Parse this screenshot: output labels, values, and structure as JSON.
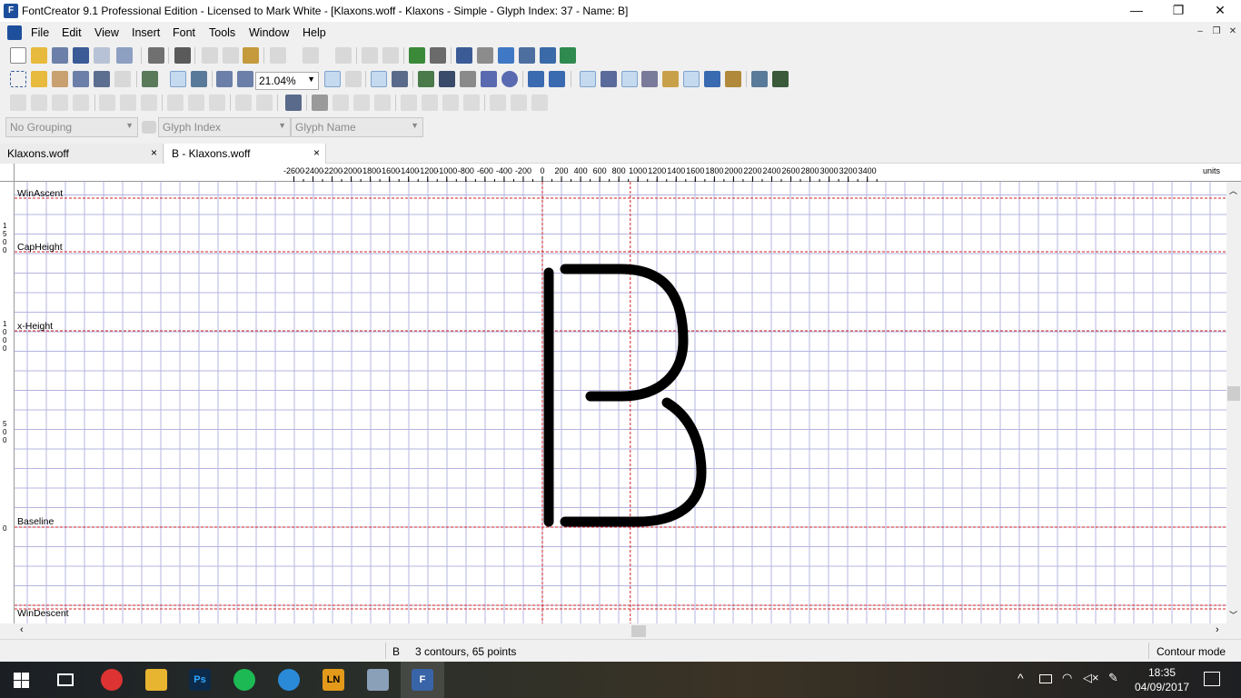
{
  "window": {
    "title": "FontCreator 9.1 Professional Edition - Licensed to Mark White - [Klaxons.woff - Klaxons - Simple - Glyph Index: 37 - Name: B]",
    "app_icon": "F",
    "minimize": "—",
    "restore": "❐",
    "close": "✕"
  },
  "menu": {
    "items": [
      "File",
      "Edit",
      "View",
      "Insert",
      "Font",
      "Tools",
      "Window",
      "Help"
    ],
    "mdi_minimize": "–",
    "mdi_restore": "❐",
    "mdi_close": "✕"
  },
  "toolbar": {
    "zoom_value": "21.04%"
  },
  "grouping": {
    "grouping_value": "No Grouping",
    "index_value": "Glyph Index",
    "name_value": "Glyph Name"
  },
  "tabs": [
    {
      "label": "Klaxons.woff",
      "close": "×"
    },
    {
      "label": "B - Klaxons.woff",
      "close": "×"
    }
  ],
  "ruler": {
    "ticks": [
      "-2600",
      "-2400",
      "-2200",
      "-2000",
      "-1800",
      "-1600",
      "-1400",
      "-1200",
      "-1000",
      "-800",
      "-600",
      "-400",
      "-200",
      "0",
      "200",
      "400",
      "600",
      "800",
      "1000",
      "1200",
      "1400",
      "1600",
      "1800",
      "2000",
      "2200",
      "2400",
      "2600",
      "2800",
      "3000",
      "3200",
      "3400"
    ],
    "units_label": "units",
    "left_labels": [
      "1\n5\n0\n0",
      "1\n0\n0\n0",
      "5\n0\n0",
      "0"
    ]
  },
  "guidelines": {
    "win_ascent": "WinAscent",
    "cap_height": "CapHeight",
    "x_height": "x-Height",
    "baseline": "Baseline",
    "win_descent": "WinDescent"
  },
  "status": {
    "glyph": "B",
    "info": "3 contours, 65 points",
    "mode": "Contour mode"
  },
  "taskbar": {
    "apps": [
      "chrome",
      "explorer",
      "Ps",
      "spotify",
      "browser",
      "LN",
      "preview",
      "F"
    ],
    "time": "18:35",
    "date": "04/09/2017"
  }
}
